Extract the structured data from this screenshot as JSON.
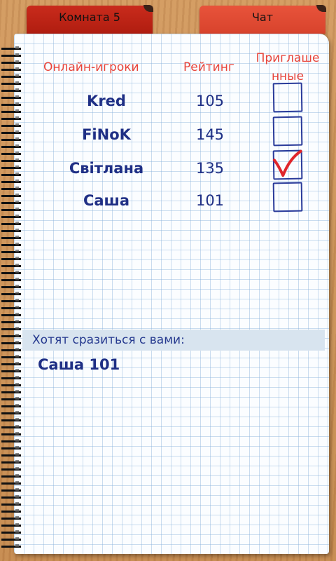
{
  "tabs": {
    "room": "Комната 5",
    "chat": "Чат"
  },
  "table": {
    "headers": {
      "players": "Онлайн-игроки",
      "rating": "Рейтинг",
      "invited_line1": "Приглаше",
      "invited_line2": "нные"
    },
    "rows": [
      {
        "name": "Kred",
        "rating": "105",
        "invited": false
      },
      {
        "name": "FiNoK",
        "rating": "145",
        "invited": false
      },
      {
        "name": "Світлана",
        "rating": "135",
        "invited": true
      },
      {
        "name": "Саша",
        "rating": "101",
        "invited": false
      }
    ]
  },
  "challenges": {
    "title": "Хотят сразиться с вами:",
    "items": [
      "Саша 101"
    ]
  },
  "colors": {
    "header_red": "#e8443a",
    "ink_blue": "#1f2f85",
    "check_red": "#e0262b"
  }
}
